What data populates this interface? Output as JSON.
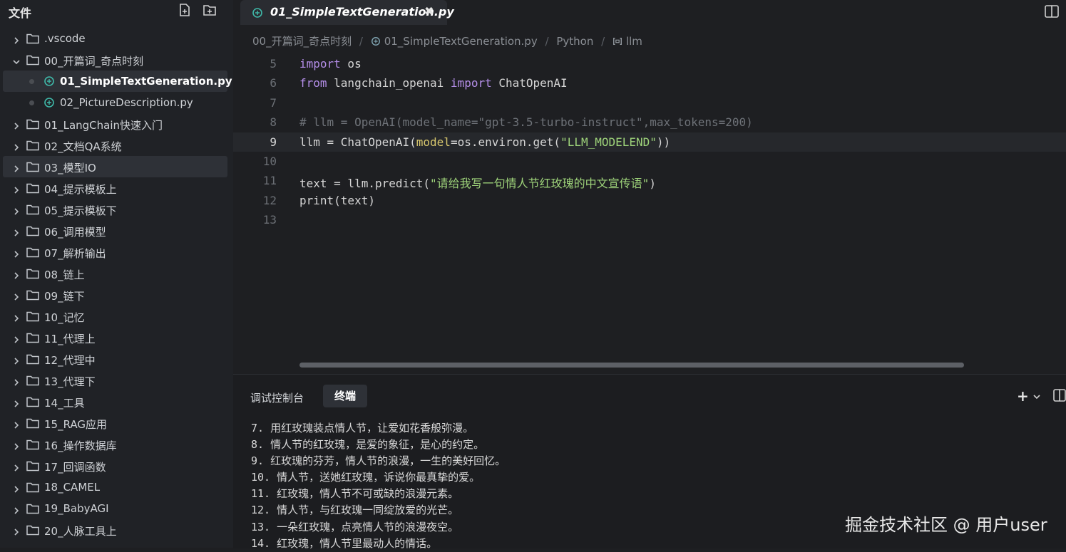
{
  "sidebar": {
    "title": "文件",
    "actions": [
      "new-file-icon",
      "new-folder-icon"
    ],
    "items": [
      {
        "label": ".vscode",
        "type": "folder",
        "expanded": false
      },
      {
        "label": "00_开篇词_奇点时刻",
        "type": "folder",
        "expanded": true
      },
      {
        "label": "01_SimpleTextGeneration.py",
        "type": "file",
        "active": true
      },
      {
        "label": "02_PictureDescription.py",
        "type": "file"
      },
      {
        "label": "01_LangChain快速入门",
        "type": "folder",
        "expanded": false
      },
      {
        "label": "02_文档QA系统",
        "type": "folder",
        "expanded": false
      },
      {
        "label": "03_模型IO",
        "type": "folder",
        "expanded": false,
        "hovered": true
      },
      {
        "label": "04_提示模板上",
        "type": "folder",
        "expanded": false
      },
      {
        "label": "05_提示模板下",
        "type": "folder",
        "expanded": false
      },
      {
        "label": "06_调用模型",
        "type": "folder",
        "expanded": false
      },
      {
        "label": "07_解析输出",
        "type": "folder",
        "expanded": false
      },
      {
        "label": "08_链上",
        "type": "folder",
        "expanded": false
      },
      {
        "label": "09_链下",
        "type": "folder",
        "expanded": false
      },
      {
        "label": "10_记忆",
        "type": "folder",
        "expanded": false
      },
      {
        "label": "11_代理上",
        "type": "folder",
        "expanded": false
      },
      {
        "label": "12_代理中",
        "type": "folder",
        "expanded": false
      },
      {
        "label": "13_代理下",
        "type": "folder",
        "expanded": false
      },
      {
        "label": "14_工具",
        "type": "folder",
        "expanded": false
      },
      {
        "label": "15_RAG应用",
        "type": "folder",
        "expanded": false
      },
      {
        "label": "16_操作数据库",
        "type": "folder",
        "expanded": false
      },
      {
        "label": "17_回调函数",
        "type": "folder",
        "expanded": false
      },
      {
        "label": "18_CAMEL",
        "type": "folder",
        "expanded": false
      },
      {
        "label": "19_BabyAGI",
        "type": "folder",
        "expanded": false
      },
      {
        "label": "20_人脉工具上",
        "type": "folder",
        "expanded": false
      }
    ]
  },
  "editor": {
    "tab": {
      "label": "01_SimpleTextGeneration.py",
      "close": "✖"
    },
    "breadcrumb": {
      "folder": "00_开篇词_奇点时刻",
      "file": "01_SimpleTextGeneration.py",
      "language": "Python",
      "symbol": "llm"
    },
    "lines": [
      {
        "n": "5"
      },
      {
        "n": "6"
      },
      {
        "n": "7"
      },
      {
        "n": "8"
      },
      {
        "n": "9",
        "current": true
      },
      {
        "n": "10"
      },
      {
        "n": "11"
      },
      {
        "n": "12"
      },
      {
        "n": "13"
      }
    ],
    "code": {
      "l5_kw": "import",
      "l5_rest": " os",
      "l6_kw1": "from",
      "l6_mid": " langchain_openai ",
      "l6_kw2": "import",
      "l6_rest": " ChatOpenAI",
      "l8_comment": "# llm = OpenAI(model_name=\"gpt-3.5-turbo-instruct\",max_tokens=200)",
      "l9_a": "llm = ChatOpenAI(",
      "l9_param": "model",
      "l9_b": "=os.environ.get(",
      "l9_str": "\"LLM_MODELEND\"",
      "l9_c": "))",
      "l11_a": "text = llm.predict(",
      "l11_str": "\"请给我写一句情人节红玫瑰的中文宣传语\"",
      "l11_b": ")",
      "l12": "print(text)"
    }
  },
  "panel": {
    "tabs": {
      "debug": "调试控制台",
      "terminal": "终端"
    },
    "add": "+",
    "output": [
      "7. 用红玫瑰装点情人节，让爱如花香般弥漫。",
      "8. 情人节的红玫瑰，是爱的象征，是心的约定。",
      "9. 红玫瑰的芬芳，情人节的浪漫，一生的美好回忆。",
      "10. 情人节，送她红玫瑰，诉说你最真挚的爱。",
      "11. 红玫瑰，情人节不可或缺的浪漫元素。",
      "12. 情人节，与红玫瑰一同绽放爱的光芒。",
      "13. 一朵红玫瑰，点亮情人节的浪漫夜空。",
      "14. 红玫瑰，情人节里最动人的情话。"
    ]
  },
  "watermark": "掘金技术社区 @ 用户user",
  "colors": {
    "keyword": "#b48ee8",
    "string": "#9ed37a",
    "comment": "#6e7278",
    "param": "#d9c86e",
    "python_icon": "#3fb9a9"
  }
}
